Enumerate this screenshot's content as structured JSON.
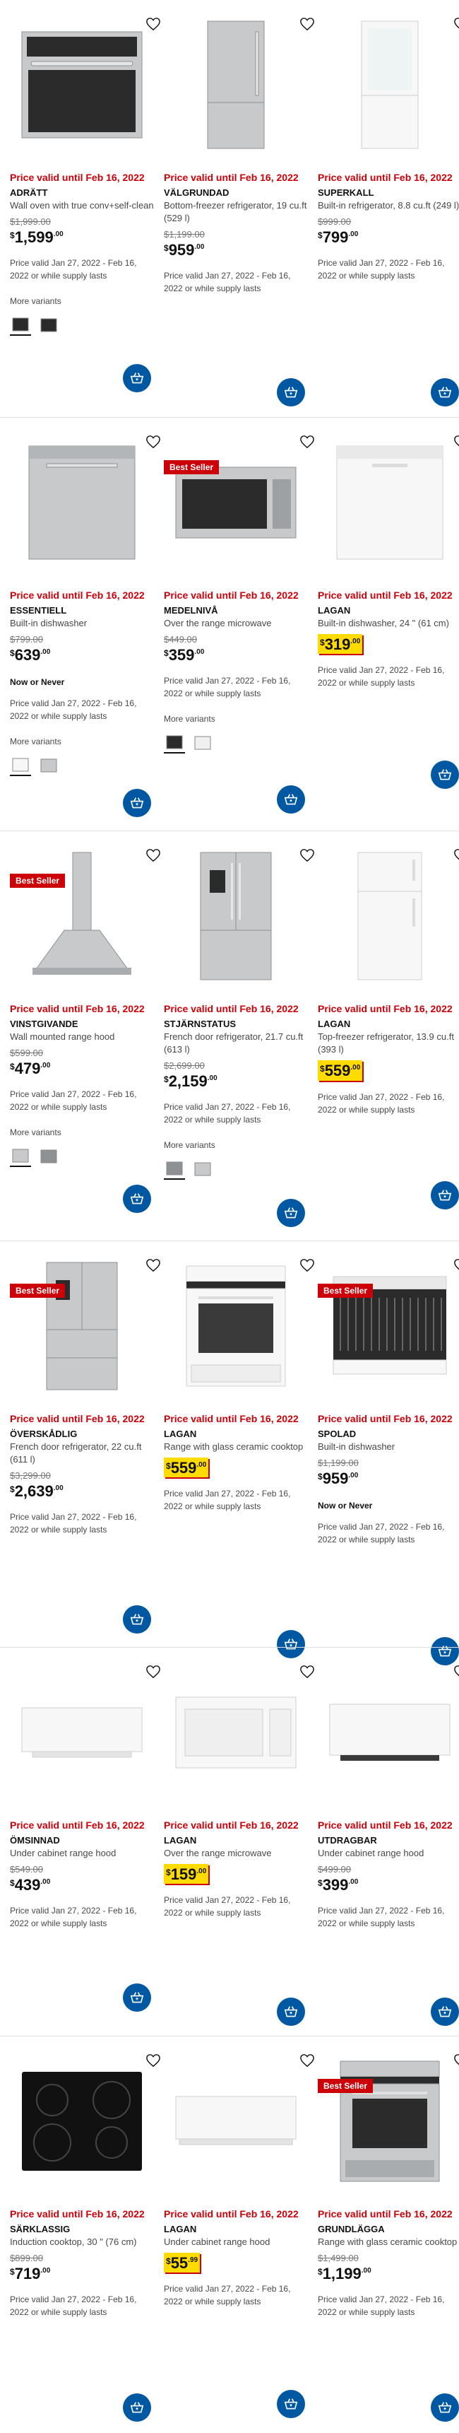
{
  "common": {
    "price_valid": "Price valid until Feb 16, 2022",
    "valid_range": "Price valid Jan 27, 2022 - Feb 16, 2022 or while supply lasts",
    "more_variants": "More variants",
    "now_or_never": "Now or Never",
    "best_seller": "Best Seller",
    "currency": "$"
  },
  "products": [
    {
      "name": "ADRÄTT",
      "desc": "Wall oven with true conv+self-clean",
      "was": "$1,999.00",
      "dollars": "1,599",
      "cents": ".00",
      "highlight": false,
      "best_seller": false,
      "now_or_never": false,
      "variants": true,
      "img": "oven"
    },
    {
      "name": "VÄLGRUNDAD",
      "desc": "Bottom-freezer refrigerator, 19 cu.ft (529 l)",
      "was": "$1,199.00",
      "dollars": "959",
      "cents": ".00",
      "highlight": false,
      "best_seller": false,
      "now_or_never": false,
      "variants": false,
      "img": "fridge-steel"
    },
    {
      "name": "SUPERKALL",
      "desc": "Built-in refrigerator, 8.8 cu.ft (249 l)",
      "was": "$999.00",
      "dollars": "799",
      "cents": ".00",
      "highlight": false,
      "best_seller": false,
      "now_or_never": false,
      "variants": false,
      "img": "fridge-builtin"
    },
    {
      "name": "ESSENTIELL",
      "desc": "Built-in dishwasher",
      "was": "$799.00",
      "dollars": "639",
      "cents": ".00",
      "highlight": false,
      "best_seller": false,
      "now_or_never": true,
      "variants": true,
      "img": "dishwasher-steel"
    },
    {
      "name": "MEDELNIVÅ",
      "desc": "Over the range microwave",
      "was": "$449.00",
      "dollars": "359",
      "cents": ".00",
      "highlight": false,
      "best_seller": true,
      "now_or_never": false,
      "variants": true,
      "img": "microwave-steel"
    },
    {
      "name": "LAGAN",
      "desc": "Built-in dishwasher, 24 \" (61 cm)",
      "was": "",
      "dollars": "319",
      "cents": ".00",
      "highlight": true,
      "best_seller": false,
      "now_or_never": false,
      "variants": false,
      "img": "dishwasher-white"
    },
    {
      "name": "VINSTGIVANDE",
      "desc": "Wall mounted range hood",
      "was": "$599.00",
      "dollars": "479",
      "cents": ".00",
      "highlight": false,
      "best_seller": true,
      "now_or_never": false,
      "variants": true,
      "img": "hood-chimney"
    },
    {
      "name": "STJÄRNSTATUS",
      "desc": "French door refrigerator, 21.7 cu.ft (613 l)",
      "was": "$2,699.00",
      "dollars": "2,159",
      "cents": ".00",
      "highlight": false,
      "best_seller": false,
      "now_or_never": false,
      "variants": true,
      "img": "fridge-french"
    },
    {
      "name": "LAGAN",
      "desc": "Top-freezer refrigerator, 13.9 cu.ft (393 l)",
      "was": "",
      "dollars": "559",
      "cents": ".00",
      "highlight": true,
      "best_seller": false,
      "now_or_never": false,
      "variants": false,
      "img": "fridge-white"
    },
    {
      "name": "ÖVERSKÅDLIG",
      "desc": "French door refrigerator, 22 cu.ft (611 l)",
      "was": "$3,299.00",
      "dollars": "2,639",
      "cents": ".00",
      "highlight": false,
      "best_seller": true,
      "now_or_never": false,
      "variants": false,
      "img": "fridge-french4"
    },
    {
      "name": "LAGAN",
      "desc": "Range with glass ceramic cooktop",
      "was": "",
      "dollars": "559",
      "cents": ".00",
      "highlight": true,
      "best_seller": false,
      "now_or_never": false,
      "variants": false,
      "img": "range-white"
    },
    {
      "name": "SPOLAD",
      "desc": "Built-in dishwasher",
      "was": "$1,199.00",
      "dollars": "959",
      "cents": ".00",
      "highlight": false,
      "best_seller": true,
      "now_or_never": true,
      "variants": false,
      "img": "dishwasher-open"
    },
    {
      "name": "ÖMSINNAD",
      "desc": "Under cabinet range hood",
      "was": "$549.00",
      "dollars": "439",
      "cents": ".00",
      "highlight": false,
      "best_seller": false,
      "now_or_never": false,
      "variants": false,
      "img": "hood-white"
    },
    {
      "name": "LAGAN",
      "desc": "Over the range microwave",
      "was": "",
      "dollars": "159",
      "cents": ".00",
      "highlight": true,
      "best_seller": false,
      "now_or_never": false,
      "variants": false,
      "img": "microwave-white"
    },
    {
      "name": "UTDRAGBAR",
      "desc": "Under cabinet range hood",
      "was": "$499.00",
      "dollars": "399",
      "cents": ".00",
      "highlight": false,
      "best_seller": false,
      "now_or_never": false,
      "variants": false,
      "img": "hood-slim"
    },
    {
      "name": "SÄRKLASSIG",
      "desc": "Induction cooktop, 30 \" (76 cm)",
      "was": "$899.00",
      "dollars": "719",
      "cents": ".00",
      "highlight": false,
      "best_seller": false,
      "now_or_never": false,
      "variants": false,
      "img": "cooktop"
    },
    {
      "name": "LAGAN",
      "desc": "Under cabinet range hood",
      "was": "",
      "dollars": "55",
      "cents": ".99",
      "highlight": true,
      "best_seller": false,
      "now_or_never": false,
      "variants": false,
      "img": "hood-small"
    },
    {
      "name": "GRUNDLÄGGA",
      "desc": "Range with glass ceramic cooktop",
      "was": "$1,499.00",
      "dollars": "1,199",
      "cents": ".00",
      "highlight": false,
      "best_seller": true,
      "now_or_never": false,
      "variants": false,
      "img": "range-steel"
    }
  ],
  "colors": {
    "price_red": "#cc0008",
    "cart_blue": "#0058a3",
    "highlight_yellow": "#ffdb00"
  },
  "icons": {
    "favorite": "heart-icon",
    "cart": "add-to-cart-icon"
  }
}
